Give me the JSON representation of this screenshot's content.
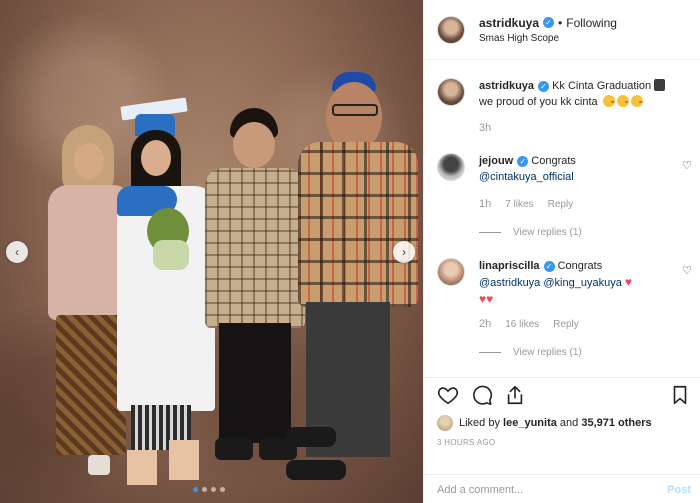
{
  "post": {
    "username": "astridkuya",
    "follow_sep": "•",
    "follow_status": "Following",
    "location": "Smas High Scope",
    "carousel": {
      "prev_icon": "‹",
      "next_icon": "›",
      "slide_count": 4,
      "active_slide": 1
    }
  },
  "caption": {
    "username": "astridkuya",
    "text_line1": "Kk Cinta Graduation",
    "text_line2": "we proud of you kk cinta",
    "time": "3h"
  },
  "comments": [
    {
      "username": "jejouw",
      "text": "Congrats",
      "mention": "@cintakuya_official",
      "time": "1h",
      "likes": "7 likes",
      "reply": "Reply",
      "view_replies": "View replies (1)"
    },
    {
      "username": "linapriscilla",
      "text": "Congrats",
      "mention1": "@astridkuya",
      "mention2": "@king_uyakuya",
      "time": "2h",
      "likes": "16 likes",
      "reply": "Reply",
      "view_replies": "View replies (1)"
    }
  ],
  "actions": {
    "liked_by_prefix": "Liked by",
    "liked_by_user": "lee_yunita",
    "and": "and",
    "others": "35,971 others",
    "time_ago": "3 HOURS AGO"
  },
  "add_comment": {
    "placeholder": "Add a comment...",
    "post_label": "Post"
  },
  "colors": {
    "accent": "#3897f0",
    "heart_red": "#ed4956",
    "muted": "#999999",
    "post_disabled": "#b2dffc"
  }
}
